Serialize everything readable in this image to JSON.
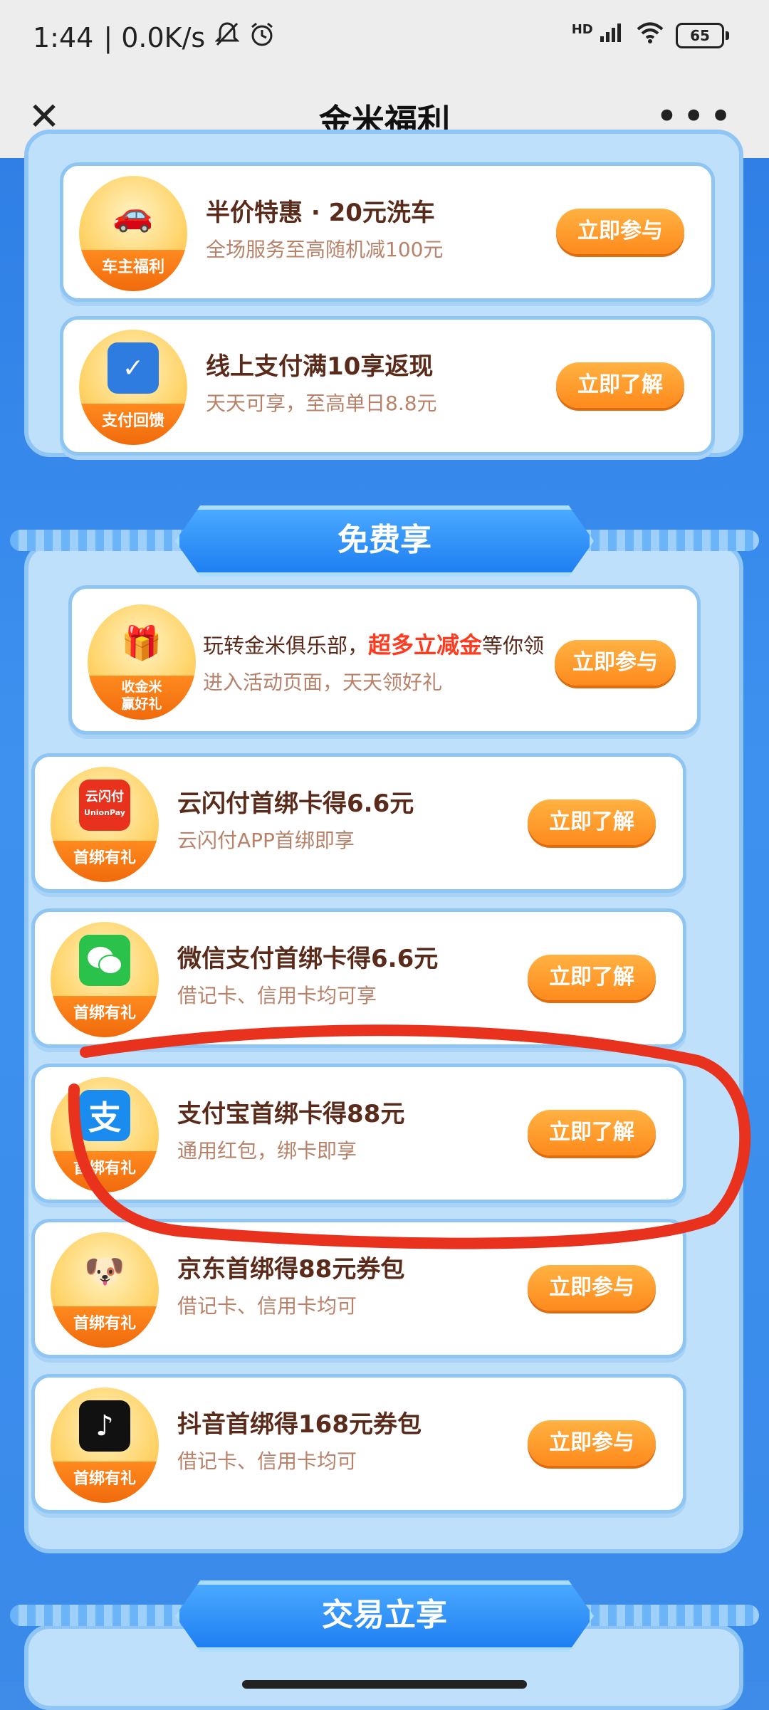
{
  "status": {
    "time": "1:44",
    "net_speed": "| 0.0K/s",
    "signal_label": "HD",
    "battery": "65"
  },
  "nav": {
    "title": "金米福利"
  },
  "top_cards": [
    {
      "title": "半价特惠 · 20元洗车",
      "subtitle": "全场服务至高随机减100元",
      "tag": "车主福利",
      "cta": "立即参与"
    },
    {
      "title": "线上支付满10享返现",
      "subtitle": "天天可享，至高单日8.8元",
      "tag": "支付回馈",
      "cta": "立即了解"
    }
  ],
  "section_free": {
    "header": "免费享",
    "cards": [
      {
        "title_pre": "玩转金米俱乐部，",
        "title_highlight": "超多立减金",
        "title_post": "等你领",
        "subtitle": "进入活动页面，天天领好礼",
        "tag": "收金米\n赢好礼",
        "cta": "立即参与"
      },
      {
        "title": "云闪付首绑卡得6.6元",
        "subtitle": "云闪付APP首绑即享",
        "tag": "首绑有礼",
        "art": "云闪付",
        "art_sub": "UnionPay",
        "cta": "立即了解"
      },
      {
        "title": "微信支付首绑卡得6.6元",
        "subtitle": "借记卡、信用卡均可享",
        "tag": "首绑有礼",
        "cta": "立即了解"
      },
      {
        "title": "支付宝首绑卡得88元",
        "subtitle": "通用红包，绑卡即享",
        "tag": "首绑有礼",
        "art": "支",
        "cta": "立即了解"
      },
      {
        "title": "京东首绑得88元券包",
        "subtitle": "借记卡、信用卡均可",
        "tag": "首绑有礼",
        "cta": "立即参与"
      },
      {
        "title": "抖音首绑得168元券包",
        "subtitle": "借记卡、信用卡均可",
        "tag": "首绑有礼",
        "cta": "立即参与"
      }
    ]
  },
  "section_trade": {
    "header": "交易立享"
  },
  "colors": {
    "accent_orange": "#ff8a1c",
    "panel_blue": "#bfe0fb",
    "annotation_red": "#e8321e"
  }
}
